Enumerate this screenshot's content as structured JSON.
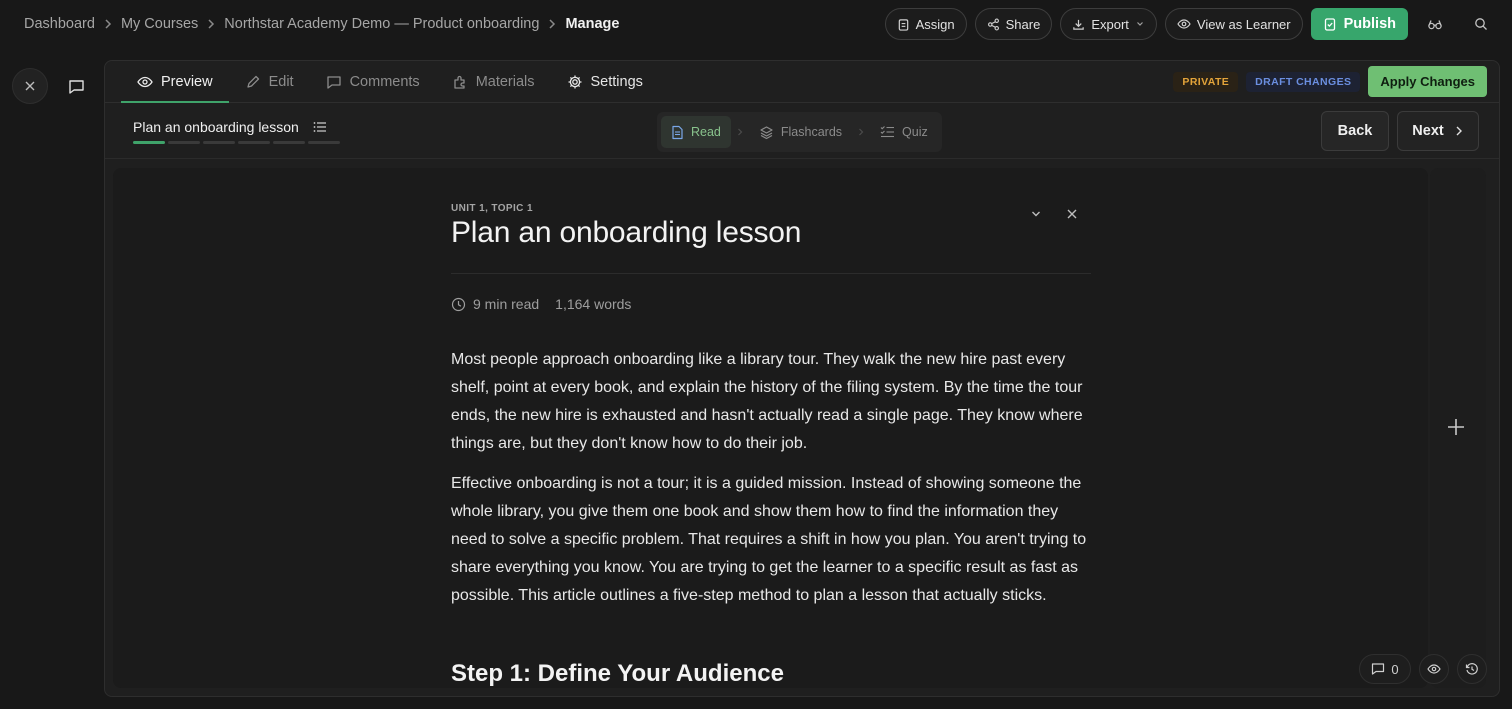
{
  "breadcrumb": {
    "items": [
      "Dashboard",
      "My Courses",
      "Northstar Academy Demo — Product onboarding"
    ],
    "current": "Manage"
  },
  "toolbar": {
    "assign": "Assign",
    "share": "Share",
    "export": "Export",
    "view_as_learner": "View as Learner",
    "publish": "Publish"
  },
  "tabs": {
    "preview": "Preview",
    "edit": "Edit",
    "comments": "Comments",
    "materials": "Materials",
    "settings": "Settings"
  },
  "status": {
    "private": "PRIVATE",
    "draft_changes": "DRAFT CHANGES",
    "apply": "Apply Changes"
  },
  "lesson": {
    "title": "Plan an onboarding lesson",
    "progress_segments": 6,
    "progress_done": 1
  },
  "modes": {
    "read": "Read",
    "flashcards": "Flashcards",
    "quiz": "Quiz"
  },
  "nav": {
    "back": "Back",
    "next": "Next"
  },
  "article": {
    "eyebrow": "UNIT 1, TOPIC 1",
    "title": "Plan an onboarding lesson",
    "read_time": "9 min read",
    "word_count": "1,164 words",
    "paragraphs": [
      "Most people approach onboarding like a library tour. They walk the new hire past every shelf, point at every book, and explain the history of the filing system. By the time the tour ends, the new hire is exhausted and hasn't actually read a single page. They know where things are, but they don't know how to do their job.",
      "Effective onboarding is not a tour; it is a guided mission. Instead of showing someone the whole library, you give them one book and show them how to find the information they need to solve a specific problem. That requires a shift in how you plan. You aren't trying to share everything you know. You are trying to get the learner to a specific result as fast as possible. This article outlines a five-step method to plan a lesson that actually sticks."
    ],
    "heading": "Step 1: Define Your Audience"
  },
  "footer_tools": {
    "comment_count": "0"
  },
  "icons": [
    "chevron-right-icon",
    "clipboard-icon",
    "share-icon",
    "download-icon",
    "eye-icon",
    "glasses-icon",
    "search-icon",
    "close-icon",
    "chat-icon",
    "pencil-icon",
    "puzzle-icon",
    "gear-icon",
    "list-icon",
    "document-icon",
    "layers-icon",
    "checklist-icon",
    "chevron-down-icon",
    "clock-icon",
    "plus-icon",
    "history-icon"
  ],
  "colors": {
    "accent": "#37a66c",
    "apply": "#6fbf73",
    "private": "#e3a43a",
    "draft": "#6b8fe0"
  }
}
